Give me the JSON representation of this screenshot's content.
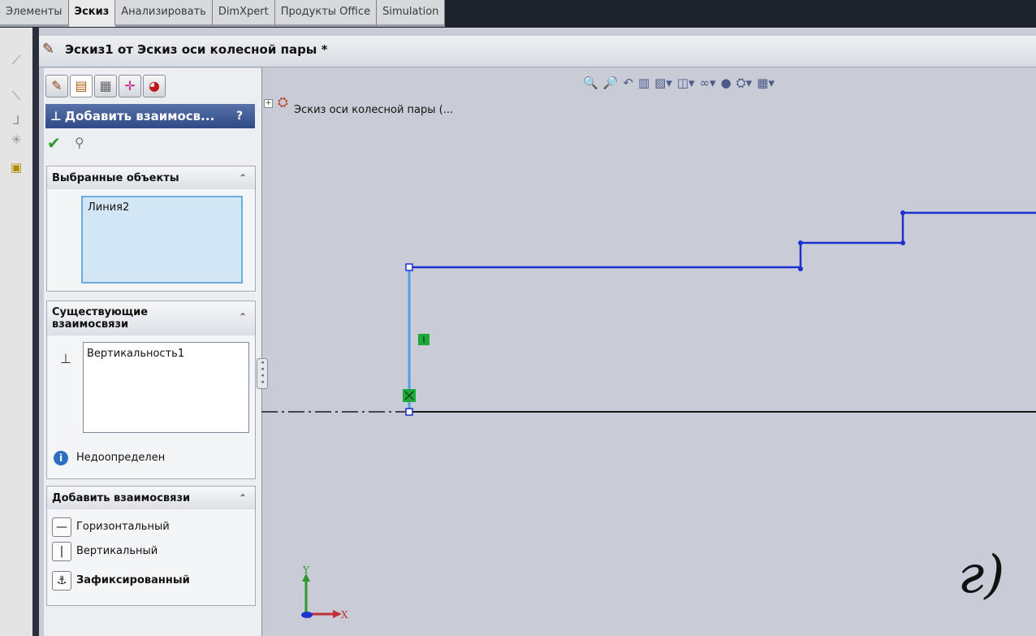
{
  "top_tabs": [
    "Элементы",
    "Эскиз",
    "Анализировать",
    "DimXpert",
    "Продукты Office",
    "Simulation"
  ],
  "active_tab": "Эскиз",
  "title": "Эскиз1 от Эскиз оси колесной пары *",
  "property_manager": {
    "header": "Добавить взаимосв...",
    "help": "?",
    "selected_objects": {
      "title": "Выбранные объекты",
      "items": [
        "Линия2"
      ]
    },
    "existing_relations": {
      "title": "Существующие взаимосвязи",
      "items": [
        "Вертикальность1"
      ],
      "status": "Недоопределен"
    },
    "add_relations": {
      "title": "Добавить взаимосвязи",
      "items": [
        "Горизонтальный",
        "Вертикальный",
        "Зафиксированный"
      ]
    }
  },
  "feature_tree": {
    "expander": "+",
    "label": "Эскиз оси колесной пары (..."
  },
  "triad": {
    "x_label": "X",
    "y_label": "Y"
  },
  "corner_mark": "г)",
  "colors": {
    "sketch_line": "#1c2fd0",
    "selected_line": "#4f9fe6",
    "centerline": "#1a1a1a",
    "relation_marker": "#1fa83a"
  }
}
